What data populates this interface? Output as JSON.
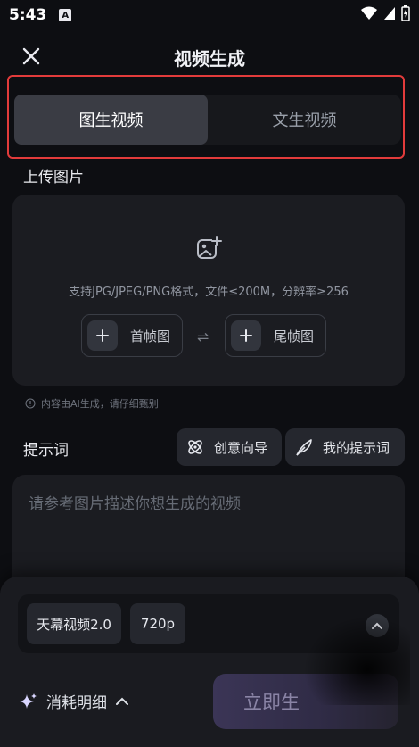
{
  "status": {
    "time": "5:43",
    "badge": "A"
  },
  "header": {
    "title": "视频生成"
  },
  "tabs": [
    {
      "label": "图生视频",
      "active": true
    },
    {
      "label": "文生视频",
      "active": false
    }
  ],
  "upload": {
    "section_title": "上传图片",
    "hint": "支持JPG/JPEG/PNG格式，文件≤200M，分辨率≥256",
    "first_frame_label": "首帧图",
    "last_frame_label": "尾帧图",
    "swap_symbol": "⇌"
  },
  "ai_note": "内容由AI生成，请仔细甄别",
  "prompt": {
    "section_title": "提示词",
    "creative_label": "创意向导",
    "my_prompts_label": "我的提示词",
    "placeholder": "请参考图片描述你想生成的视频"
  },
  "settings": {
    "model": "天幕视频2.0",
    "resolution": "720p"
  },
  "footer": {
    "cost_label": "消耗明细",
    "generate_label": "立即生"
  },
  "colors": {
    "highlight": "#e23b3b",
    "background": "#0d0e12",
    "accent": "#8a84a6"
  }
}
